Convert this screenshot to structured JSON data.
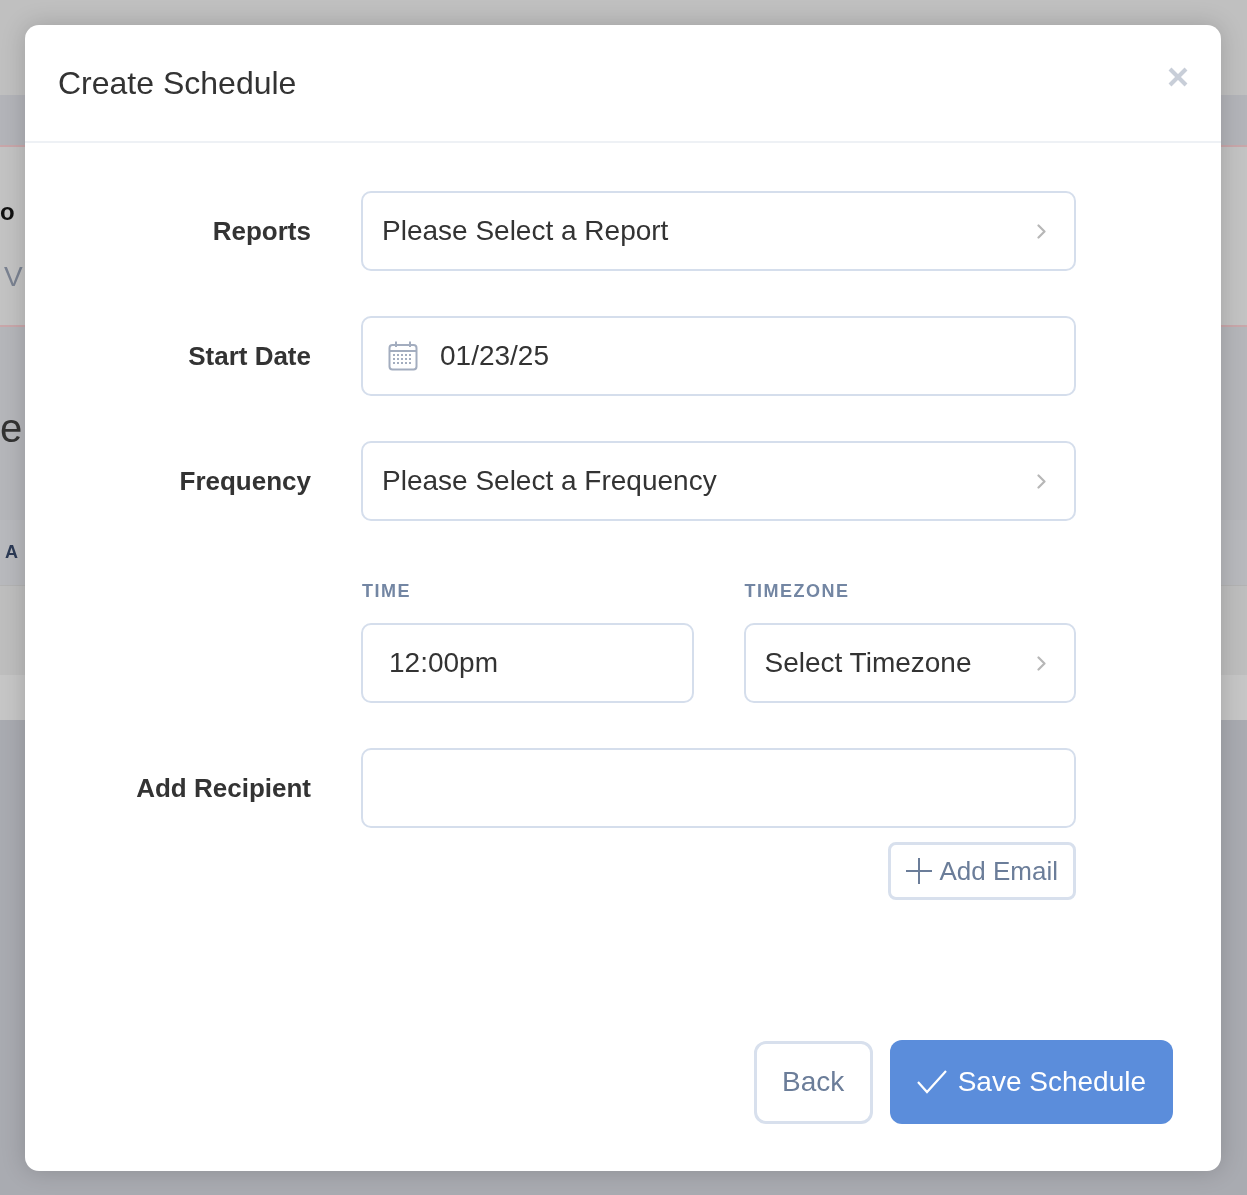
{
  "background_page": {
    "card_heading": "o",
    "card_subheading": "V",
    "section_heading": "e",
    "table_header": "A"
  },
  "modal": {
    "title": "Create Schedule",
    "fields": [
      {
        "kind": "select",
        "label": "Reports",
        "value": "Please Select a Report"
      },
      {
        "kind": "date",
        "label": "Start Date",
        "value": "01/23/25"
      },
      {
        "kind": "select",
        "label": "Frequency",
        "value": "Please Select a Frequency"
      },
      {
        "kind": "group",
        "fields": [
          {
            "kind": "text",
            "label": "TIME",
            "value": "12:00pm"
          },
          {
            "kind": "select",
            "label": "TIMEZONE",
            "value": "Select Timezone"
          }
        ]
      },
      {
        "kind": "email",
        "label": "Add Recipient",
        "button": "Add Email"
      }
    ],
    "buttons": [
      {
        "kind": "secondary",
        "label": "Back"
      },
      {
        "kind": "primary",
        "label": "Save Schedule"
      }
    ]
  }
}
